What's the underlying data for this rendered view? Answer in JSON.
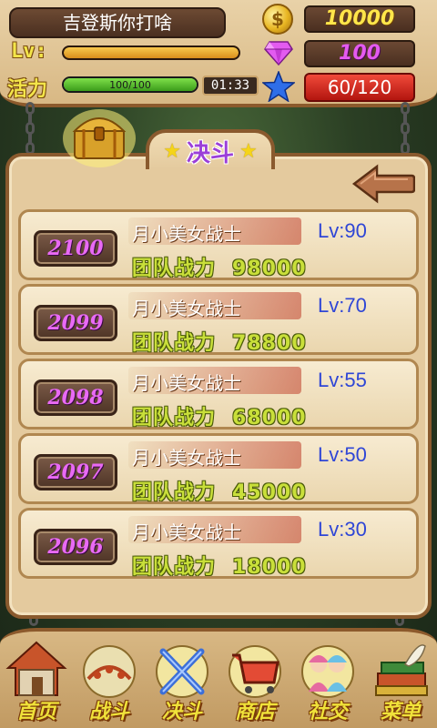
{
  "player": {
    "name": "吉登斯你打啥",
    "lv_label": "Lv:",
    "lv_progress": 1.0,
    "vitality_label": "活力",
    "vitality_text": "100/100",
    "vitality_progress": 1.0,
    "timer": "01:33"
  },
  "resources": {
    "gold": "10000",
    "gems": "100",
    "stars": "60/120",
    "gold_symbol": "$"
  },
  "panel": {
    "title": "决斗",
    "title_star": "★"
  },
  "opponents": [
    {
      "rank": "2100",
      "name": "月小美女战士",
      "level": "Lv:90",
      "power_label": "团队战力",
      "power": "98000"
    },
    {
      "rank": "2099",
      "name": "月小美女战士",
      "level": "Lv:70",
      "power_label": "团队战力",
      "power": "78800"
    },
    {
      "rank": "2098",
      "name": "月小美女战士",
      "level": "Lv:55",
      "power_label": "团队战力",
      "power": "68000"
    },
    {
      "rank": "2097",
      "name": "月小美女战士",
      "level": "Lv:50",
      "power_label": "团队战力",
      "power": "45000"
    },
    {
      "rank": "2096",
      "name": "月小美女战士",
      "level": "Lv:30",
      "power_label": "团队战力",
      "power": "18000"
    }
  ],
  "nav": [
    {
      "label": "首页",
      "icon": "house-icon"
    },
    {
      "label": "战斗",
      "icon": "battle-icon"
    },
    {
      "label": "决斗",
      "icon": "crossed-swords-icon"
    },
    {
      "label": "商店",
      "icon": "cart-icon"
    },
    {
      "label": "社交",
      "icon": "friends-icon"
    },
    {
      "label": "菜单",
      "icon": "menu-icon"
    }
  ]
}
